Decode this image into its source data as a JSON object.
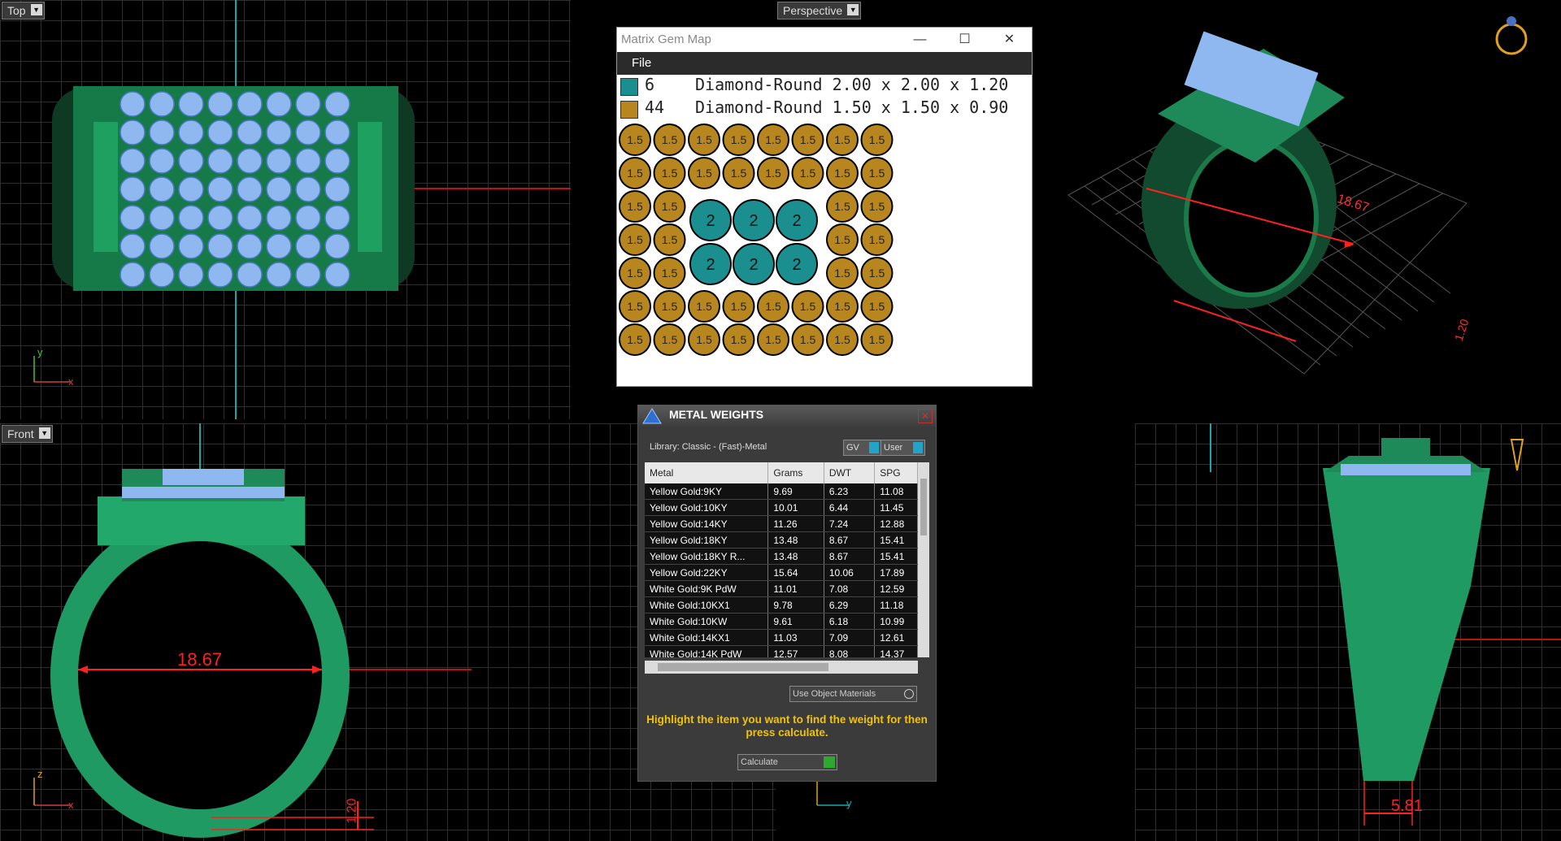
{
  "viewports": {
    "top": {
      "label": "Top"
    },
    "perspective": {
      "label": "Perspective"
    },
    "front": {
      "label": "Front",
      "dimension_width": "18.67",
      "dimension_height": "1.20"
    },
    "right": {
      "dimension_width": "5.81"
    },
    "perspective_dims": {
      "width": "18.67",
      "height": "1.20"
    }
  },
  "axes": {
    "x": "x",
    "y": "y",
    "z": "z"
  },
  "gem_map": {
    "title": "Matrix Gem Map",
    "menu_file": "File",
    "legend": [
      {
        "count": "6",
        "description": "Diamond-Round 2.00 x 2.00 x 1.20",
        "color": "#1b8f8f"
      },
      {
        "count": "44",
        "description": "Diamond-Round 1.50 x 1.50 x 0.90",
        "color": "#b8861e"
      }
    ],
    "small_label": "1.5",
    "large_label": "2",
    "window_controls": [
      "—",
      "☐",
      "✕"
    ]
  },
  "metal_weights": {
    "title": "METAL WEIGHTS",
    "library": "Library: Classic - (Fast)-Metal",
    "toggle_gv": "GV",
    "toggle_user": "User",
    "columns": [
      "Metal",
      "Grams",
      "DWT",
      "SPG"
    ],
    "rows": [
      [
        "Yellow Gold:9KY",
        "9.69",
        "6.23",
        "11.08"
      ],
      [
        "Yellow Gold:10KY",
        "10.01",
        "6.44",
        "11.45"
      ],
      [
        "Yellow Gold:14KY",
        "11.26",
        "7.24",
        "12.88"
      ],
      [
        "Yellow Gold:18KY",
        "13.48",
        "8.67",
        "15.41"
      ],
      [
        "Yellow Gold:18KY R...",
        "13.48",
        "8.67",
        "15.41"
      ],
      [
        "Yellow Gold:22KY",
        "15.64",
        "10.06",
        "17.89"
      ],
      [
        "White Gold:9K PdW",
        "11.01",
        "7.08",
        "12.59"
      ],
      [
        "White Gold:10KX1",
        "9.78",
        "6.29",
        "11.18"
      ],
      [
        "White Gold:10KW",
        "9.61",
        "6.18",
        "10.99"
      ],
      [
        "White Gold:14KX1",
        "11.03",
        "7.09",
        "12.61"
      ],
      [
        "White Gold:14K PdW",
        "12.57",
        "8.08",
        "14.37"
      ]
    ],
    "use_object_materials": "Use Object Materials",
    "hint": "Highlight the item you want to find the weight for then press calculate.",
    "calculate": "Calculate"
  },
  "colors": {
    "ring": "#1e8a5a",
    "stone": "#8fb8f0",
    "dim": "#ff2020",
    "axis": "#1aa7a7"
  }
}
